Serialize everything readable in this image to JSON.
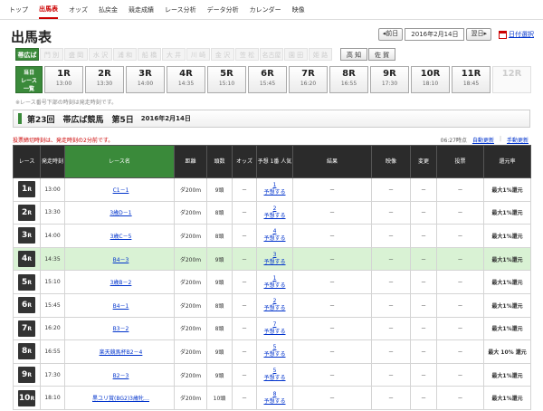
{
  "nav": [
    "トップ",
    "出馬表",
    "オッズ",
    "払戻金",
    "競走成績",
    "レース分析",
    "データ分析",
    "カレンダー",
    "映像"
  ],
  "nav_active": 1,
  "page_title": "出馬表",
  "datebar": {
    "prev": "◂前日",
    "date": "2016年2月14日",
    "next": "翌日▸",
    "calendar": "日付選択"
  },
  "venues": [
    {
      "label": "帯広ば",
      "state": "active"
    },
    {
      "label": "門 別",
      "state": "off"
    },
    {
      "label": "盛 岡",
      "state": "off"
    },
    {
      "label": "水 沢",
      "state": "off"
    },
    {
      "label": "浦 和",
      "state": "off"
    },
    {
      "label": "船 橋",
      "state": "off"
    },
    {
      "label": "大 井",
      "state": "off"
    },
    {
      "label": "川 崎",
      "state": "off"
    },
    {
      "label": "金 沢",
      "state": "off"
    },
    {
      "label": "笠 松",
      "state": "off"
    },
    {
      "label": "名古屋",
      "state": "off"
    },
    {
      "label": "園 田",
      "state": "off"
    },
    {
      "label": "姫 路",
      "state": "off"
    },
    {
      "label": "高 知",
      "state": "on"
    },
    {
      "label": "佐 賀",
      "state": "on"
    }
  ],
  "today_tab": [
    "当日",
    "レース",
    "一覧"
  ],
  "race_tabs": [
    {
      "no": "1R",
      "time": "13:00"
    },
    {
      "no": "2R",
      "time": "13:30"
    },
    {
      "no": "3R",
      "time": "14:00"
    },
    {
      "no": "4R",
      "time": "14:35"
    },
    {
      "no": "5R",
      "time": "15:10"
    },
    {
      "no": "6R",
      "time": "15:45"
    },
    {
      "no": "7R",
      "time": "16:20"
    },
    {
      "no": "8R",
      "time": "16:55"
    },
    {
      "no": "9R",
      "time": "17:30"
    },
    {
      "no": "10R",
      "time": "18:10"
    },
    {
      "no": "11R",
      "time": "18:45"
    },
    {
      "no": "12R",
      "time": ""
    }
  ],
  "race_note": "※レース番号下部の時刻は発走時刻です。",
  "event": {
    "title": "第23回　帯広ば競馬　第5日",
    "date": "2016年2月14日"
  },
  "deadline_note": "投票締切時刻は、発走時刻の2分前です。",
  "updates": {
    "time": "06:27時点",
    "auto": "自動更新",
    "manual": "手動更新"
  },
  "headers": [
    "レース",
    "発走時刻",
    "レース名",
    "距離",
    "頭数",
    "オッズ",
    "予想 1番 人気",
    "結果",
    "映像",
    "変更",
    "投票",
    "還元率"
  ],
  "rows": [
    {
      "race": "1",
      "time": "13:00",
      "name": "C1－1",
      "dist": "ダ200m",
      "heads": "9頭",
      "odds": "－",
      "fav": "1",
      "fav_link": "予想する",
      "result": "－",
      "video": "－",
      "change": "－",
      "vote": "－",
      "ret": "最大1%還元",
      "hl": false
    },
    {
      "race": "2",
      "time": "13:30",
      "name": "3歳D－1",
      "dist": "ダ200m",
      "heads": "8頭",
      "odds": "－",
      "fav": "2",
      "fav_link": "予想する",
      "result": "－",
      "video": "－",
      "change": "－",
      "vote": "－",
      "ret": "最大1%還元",
      "hl": false
    },
    {
      "race": "3",
      "time": "14:00",
      "name": "3歳C－5",
      "dist": "ダ200m",
      "heads": "8頭",
      "odds": "－",
      "fav": "4",
      "fav_link": "予想する",
      "result": "－",
      "video": "－",
      "change": "－",
      "vote": "－",
      "ret": "最大1%還元",
      "hl": false
    },
    {
      "race": "4",
      "time": "14:35",
      "name": "B4－3",
      "dist": "ダ200m",
      "heads": "9頭",
      "odds": "－",
      "fav": "3",
      "fav_link": "予想する",
      "result": "－",
      "video": "－",
      "change": "－",
      "vote": "－",
      "ret": "最大1%還元",
      "hl": true
    },
    {
      "race": "5",
      "time": "15:10",
      "name": "3歳B－2",
      "dist": "ダ200m",
      "heads": "9頭",
      "odds": "－",
      "fav": "1",
      "fav_link": "予想する",
      "result": "－",
      "video": "－",
      "change": "－",
      "vote": "－",
      "ret": "最大1%還元",
      "hl": false
    },
    {
      "race": "6",
      "time": "15:45",
      "name": "B4－1",
      "dist": "ダ200m",
      "heads": "8頭",
      "odds": "－",
      "fav": "2",
      "fav_link": "予想する",
      "result": "－",
      "video": "－",
      "change": "－",
      "vote": "－",
      "ret": "最大1%還元",
      "hl": false
    },
    {
      "race": "7",
      "time": "16:20",
      "name": "B3－2",
      "dist": "ダ200m",
      "heads": "8頭",
      "odds": "－",
      "fav": "7",
      "fav_link": "予想する",
      "result": "－",
      "video": "－",
      "change": "－",
      "vote": "－",
      "ret": "最大1%還元",
      "hl": false
    },
    {
      "race": "8",
      "time": "16:55",
      "name": "楽天競馬杯B2－4",
      "dist": "ダ200m",
      "heads": "9頭",
      "odds": "－",
      "fav": "5",
      "fav_link": "予想する",
      "result": "－",
      "video": "－",
      "change": "－",
      "vote": "－",
      "ret": "最大 10% 還元",
      "hl": false
    },
    {
      "race": "9",
      "time": "17:30",
      "name": "B2－3",
      "dist": "ダ200m",
      "heads": "9頭",
      "odds": "－",
      "fav": "5",
      "fav_link": "予想する",
      "result": "－",
      "video": "－",
      "change": "－",
      "vote": "－",
      "ret": "最大1%還元",
      "hl": false
    },
    {
      "race": "10",
      "time": "18:10",
      "name": "黒ユリ賞(BG2)3歳牝…",
      "dist": "ダ200m",
      "heads": "10頭",
      "odds": "－",
      "fav": "8",
      "fav_link": "予想する",
      "result": "－",
      "video": "－",
      "change": "－",
      "vote": "－",
      "ret": "最大1%還元",
      "hl": false
    }
  ]
}
